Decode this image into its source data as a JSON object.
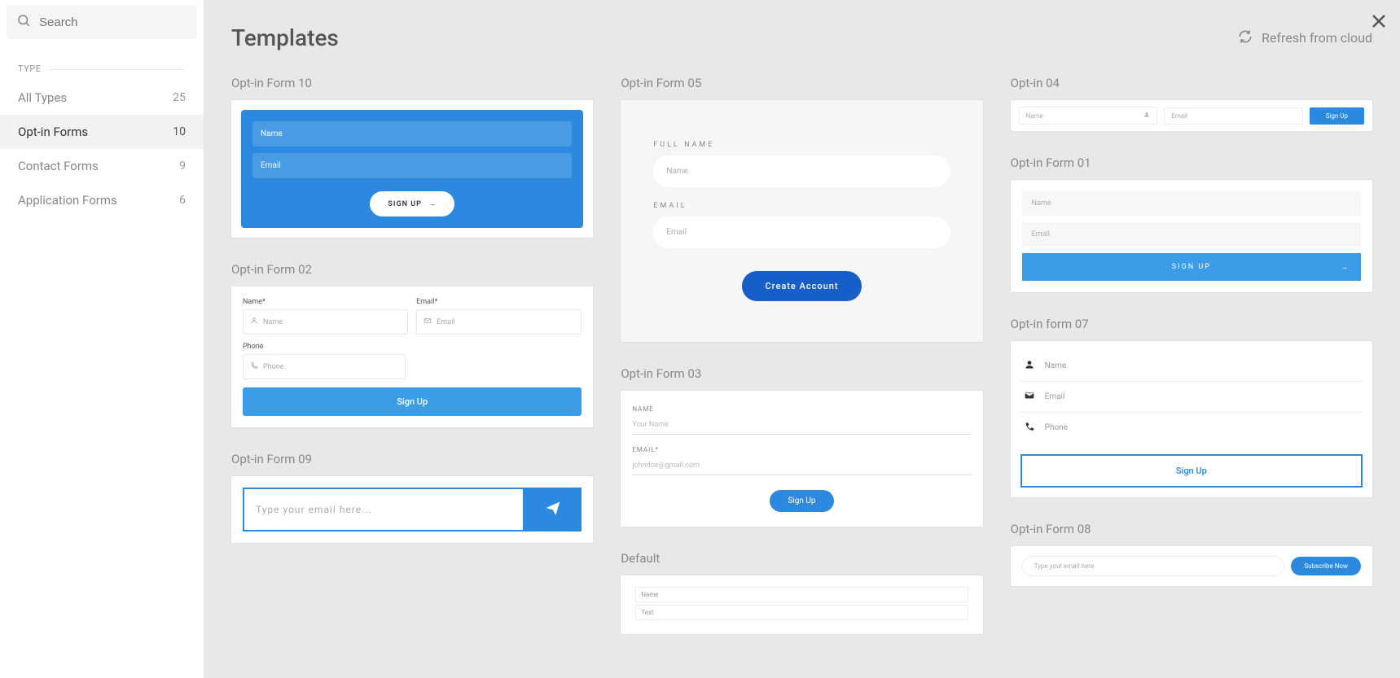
{
  "search": {
    "placeholder": "Search"
  },
  "sidebar": {
    "section": "TYPE",
    "items": [
      {
        "label": "All Types",
        "count": "25"
      },
      {
        "label": "Opt-in Forms",
        "count": "10"
      },
      {
        "label": "Contact Forms",
        "count": "9"
      },
      {
        "label": "Application Forms",
        "count": "6"
      }
    ]
  },
  "header": {
    "title": "Templates",
    "refresh": "Refresh from cloud"
  },
  "templates": {
    "t10": {
      "title": "Opt-in Form 10",
      "name": "Name",
      "email": "Email",
      "button": "SIGN UP"
    },
    "t02": {
      "title": "Opt-in Form 02",
      "nameLabel": "Name*",
      "emailLabel": "Email*",
      "phoneLabel": "Phone",
      "namePh": "Name",
      "emailPh": "Email",
      "phonePh": "Phone",
      "button": "Sign Up"
    },
    "t09": {
      "title": "Opt-in Form 09",
      "placeholder": "Type your email here..."
    },
    "t05": {
      "title": "Opt-in Form 05",
      "nameLabel": "FULL NAME",
      "emailLabel": "EMAIL",
      "namePh": "Name",
      "emailPh": "Email",
      "button": "Create Account"
    },
    "t03": {
      "title": "Opt-in Form 03",
      "nameLabel": "NAME",
      "emailLabel": "EMAIL*",
      "namePh": "Your Name",
      "emailPh": "johndoe@gmail.com",
      "button": "Sign Up"
    },
    "tdef": {
      "title": "Default",
      "namePh": "Name",
      "textPh": "Text"
    },
    "t04": {
      "title": "Opt-in 04",
      "namePh": "Name",
      "emailPh": "Email",
      "button": "Sign Up"
    },
    "t01": {
      "title": "Opt-in Form 01",
      "namePh": "Name",
      "emailPh": "Email",
      "button": "SIGN UP",
      "arrow": "→"
    },
    "t07": {
      "title": "Opt-in form 07",
      "namePh": "Name",
      "emailPh": "Email",
      "phonePh": "Phone",
      "button": "Sign Up"
    },
    "t08": {
      "title": "Opt-in Form 08",
      "placeholder": "Type your email here.",
      "button": "Subscribe Now"
    }
  }
}
